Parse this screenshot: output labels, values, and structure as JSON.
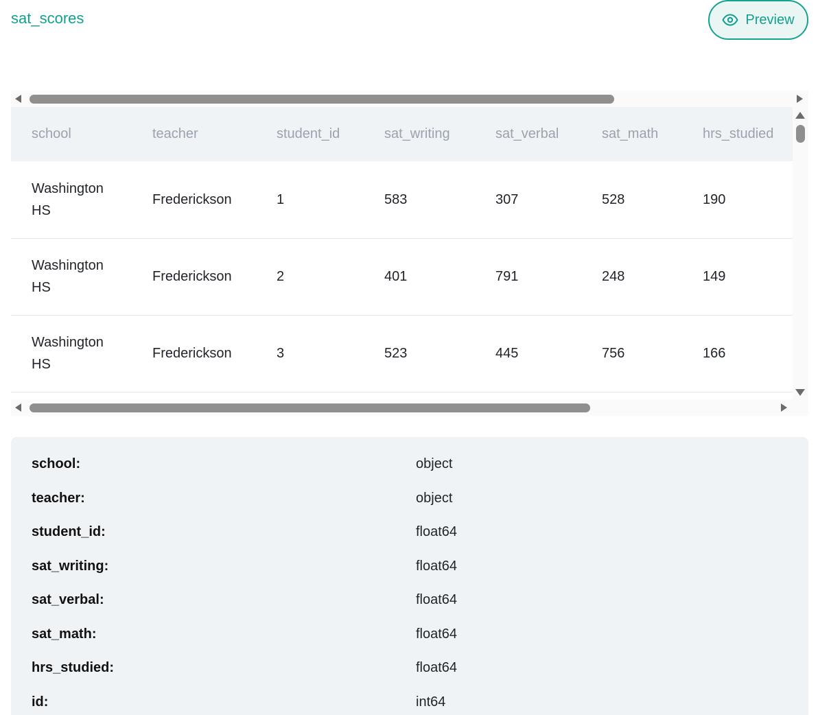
{
  "dataset": {
    "name": "sat_scores",
    "preview_label": "Preview"
  },
  "table": {
    "columns": [
      "school",
      "teacher",
      "student_id",
      "sat_writing",
      "sat_verbal",
      "sat_math",
      "hrs_studied"
    ],
    "rows": [
      [
        "Washington HS",
        "Frederickson",
        "1",
        "583",
        "307",
        "528",
        "190"
      ],
      [
        "Washington HS",
        "Frederickson",
        "2",
        "401",
        "791",
        "248",
        "149"
      ],
      [
        "Washington HS",
        "Frederickson",
        "3",
        "523",
        "445",
        "756",
        "166"
      ]
    ]
  },
  "dtypes": [
    {
      "column": "school:",
      "type": "object"
    },
    {
      "column": "teacher:",
      "type": "object"
    },
    {
      "column": "student_id:",
      "type": "float64"
    },
    {
      "column": "sat_writing:",
      "type": "float64"
    },
    {
      "column": "sat_verbal:",
      "type": "float64"
    },
    {
      "column": "sat_math:",
      "type": "float64"
    },
    {
      "column": "hrs_studied:",
      "type": "float64"
    },
    {
      "column": "id:",
      "type": "int64"
    }
  ],
  "colors": {
    "accent": "#12a08c",
    "header_bg": "#f0f3f6"
  },
  "icons": {
    "preview": "eye-icon"
  }
}
